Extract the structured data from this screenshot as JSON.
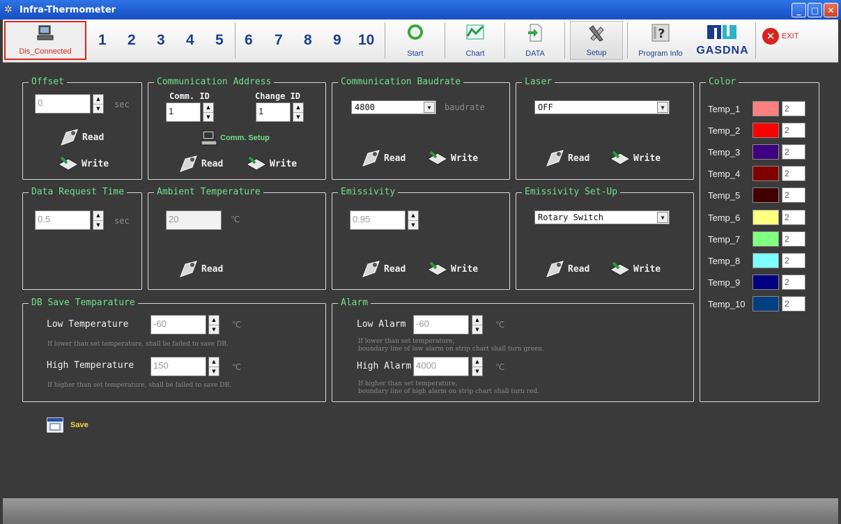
{
  "window": {
    "title": "Infra-Thermometer"
  },
  "toolbar": {
    "connection_label": "Dis_Connected",
    "channels": [
      "1",
      "2",
      "3",
      "4",
      "5",
      "6",
      "7",
      "8",
      "9",
      "10"
    ],
    "start_label": "Start",
    "chart_label": "Chart",
    "data_label": "DATA",
    "setup_label": "Setup",
    "program_info_label": "Program Info",
    "brand": "GASDNA",
    "exit_label": "EXIT"
  },
  "offset": {
    "title": "Offset",
    "value": "0",
    "unit": "sec",
    "read_label": "Read",
    "write_label": "Write"
  },
  "comm_address": {
    "title": "Communication Address",
    "comm_id_label": "Comm. ID",
    "comm_id_value": "1",
    "change_id_label": "Change ID",
    "change_id_value": "1",
    "setup_label": "Comm. Setup",
    "read_label": "Read",
    "write_label": "Write"
  },
  "baudrate": {
    "title": "Communication Baudrate",
    "value": "4800",
    "unit": "baudrate",
    "read_label": "Read",
    "write_label": "Write"
  },
  "laser": {
    "title": "Laser",
    "value": "OFF",
    "read_label": "Read",
    "write_label": "Write"
  },
  "request_time": {
    "title": "Data Request Time",
    "value": "0.5",
    "unit": "sec"
  },
  "ambient": {
    "title": "Ambient Temperature",
    "value": "20",
    "unit": "℃",
    "read_label": "Read"
  },
  "emissivity": {
    "title": "Emissivity",
    "value": "0.95",
    "read_label": "Read",
    "write_label": "Write"
  },
  "emissivity_setup": {
    "title": "Emissivity Set-Up",
    "value": "Rotary Switch",
    "read_label": "Read",
    "write_label": "Write"
  },
  "db_save": {
    "title": "DB Save Temparature",
    "low_label": "Low Temperature",
    "low_value": "-60",
    "unit": "℃",
    "low_note": "If lower than set temperature, shall be failed to save DB.",
    "high_label": "High Temperature",
    "high_value": "150",
    "high_note": "If higher than set temperature, shall be failed to save DB."
  },
  "alarm": {
    "title": "Alarm",
    "low_label": "Low Alarm",
    "low_value": "-60",
    "unit": "℃",
    "low_note_1": "If lower than set temperature,",
    "low_note_2": "boundary line of low alarm on strip chart shall turn green.",
    "high_label": "High Alarm",
    "high_value": "4000",
    "high_note_1": "If higher than set temperature,",
    "high_note_2": "boundary line of high alarm on strip chart shall turn red."
  },
  "color_panel": {
    "title": "Color",
    "items": [
      {
        "name": "Temp_1",
        "color": "#ff8080",
        "value": "2"
      },
      {
        "name": "Temp_2",
        "color": "#ff0000",
        "value": "2"
      },
      {
        "name": "Temp_3",
        "color": "#3f0080",
        "value": "2"
      },
      {
        "name": "Temp_4",
        "color": "#800000",
        "value": "2"
      },
      {
        "name": "Temp_5",
        "color": "#400000",
        "value": "2"
      },
      {
        "name": "Temp_6",
        "color": "#ffff80",
        "value": "2"
      },
      {
        "name": "Temp_7",
        "color": "#80ff80",
        "value": "2"
      },
      {
        "name": "Temp_8",
        "color": "#80ffff",
        "value": "2"
      },
      {
        "name": "Temp_9",
        "color": "#000080",
        "value": "2"
      },
      {
        "name": "Temp_10",
        "color": "#004080",
        "value": "2"
      }
    ]
  },
  "save_label": "Save"
}
